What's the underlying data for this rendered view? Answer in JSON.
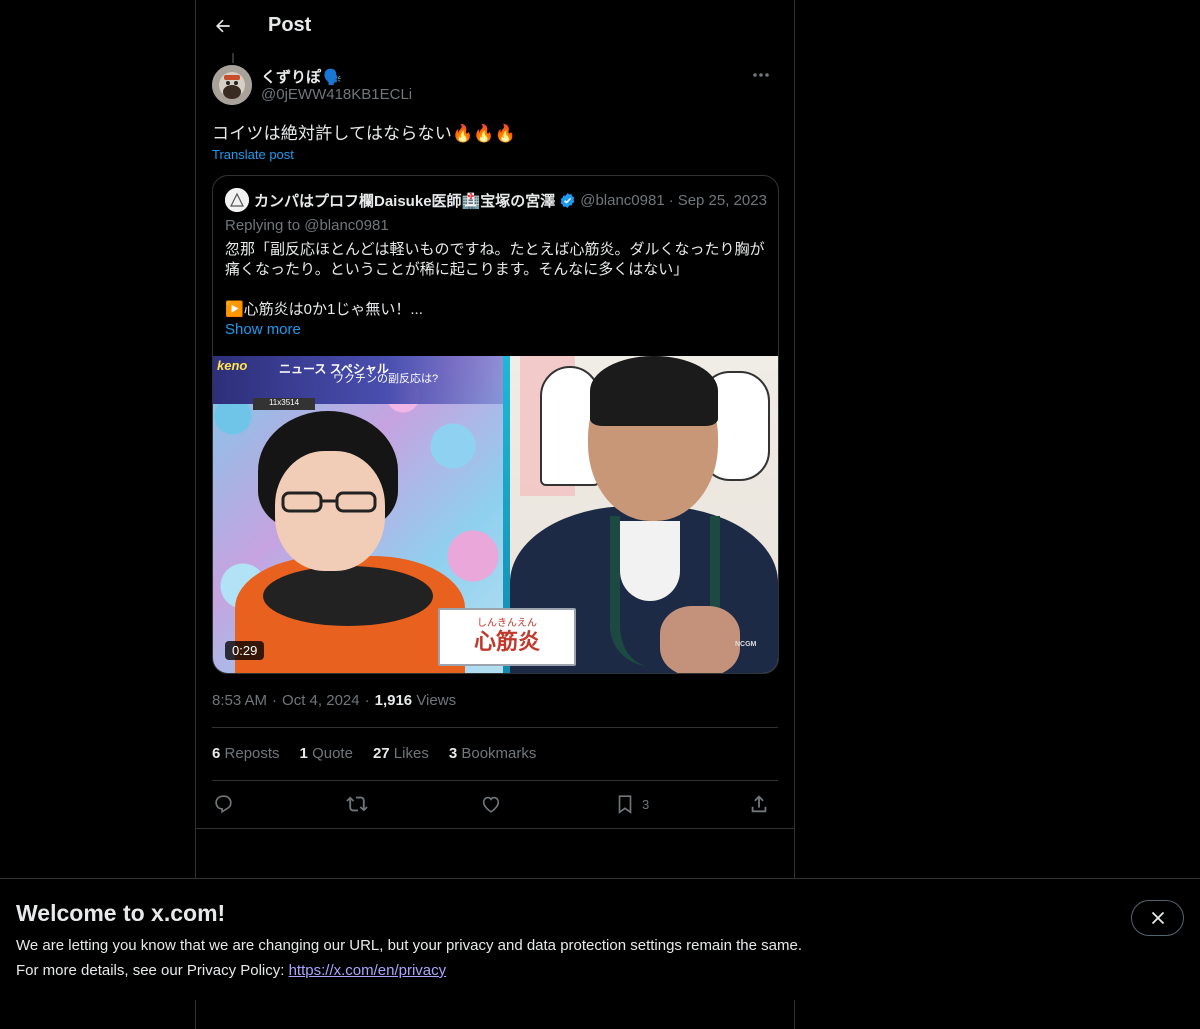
{
  "header": {
    "title": "Post"
  },
  "post": {
    "display_name": "くずりぽ",
    "name_emoji": "🗣️",
    "handle": "@0jEWW418KB1ECLi",
    "text": "コイツは絶対許してはならない🔥🔥🔥",
    "translate_label": "Translate post",
    "time": "8:53 AM",
    "date": "Oct 4, 2024",
    "views_count": "1,916",
    "views_label": "Views"
  },
  "quote": {
    "name": "カンパはプロフ欄Daisuke医師🏥宝塚の宮澤",
    "handle": "@blanc0981",
    "date": "Sep 25, 2023",
    "replying_prefix": "Replying to",
    "replying_handle": "@blanc0981",
    "body_line1": "忽那「副反応ほとんどは軽いものですね。たとえば心筋炎。ダルくなったり胸が痛くなったり。ということが稀に起こります。そんなに多くはない」",
    "body_line2": "▶️心筋炎は0か1じゃ無い！...",
    "show_more": "Show more",
    "video": {
      "duration": "0:29",
      "caption_ruby": "しんきんえん",
      "caption_main": "心筋炎",
      "banner_title": "ニュース スペシャル",
      "banner_sub": "ワクチンの副反応は?",
      "banner_logo": "keno",
      "banner_stat": "11x3514",
      "corner_text": "NCGM"
    }
  },
  "stats": [
    {
      "count": "6",
      "label": "Reposts"
    },
    {
      "count": "1",
      "label": "Quote"
    },
    {
      "count": "27",
      "label": "Likes"
    },
    {
      "count": "3",
      "label": "Bookmarks"
    }
  ],
  "actions": {
    "bookmark_count": "3"
  },
  "welcome": {
    "title": "Welcome to x.com!",
    "line1": "We are letting you know that we are changing our URL, but your privacy and data protection settings remain the same.",
    "line2_prefix": "For more details, see our Privacy Policy: ",
    "link": "https://x.com/en/privacy"
  },
  "colors": {
    "background": "#000000",
    "text": "#e7e9ea",
    "muted": "#71767b",
    "accent": "#1d9bf0",
    "border": "#2f3336",
    "link_visited": "#a9a6ff"
  }
}
